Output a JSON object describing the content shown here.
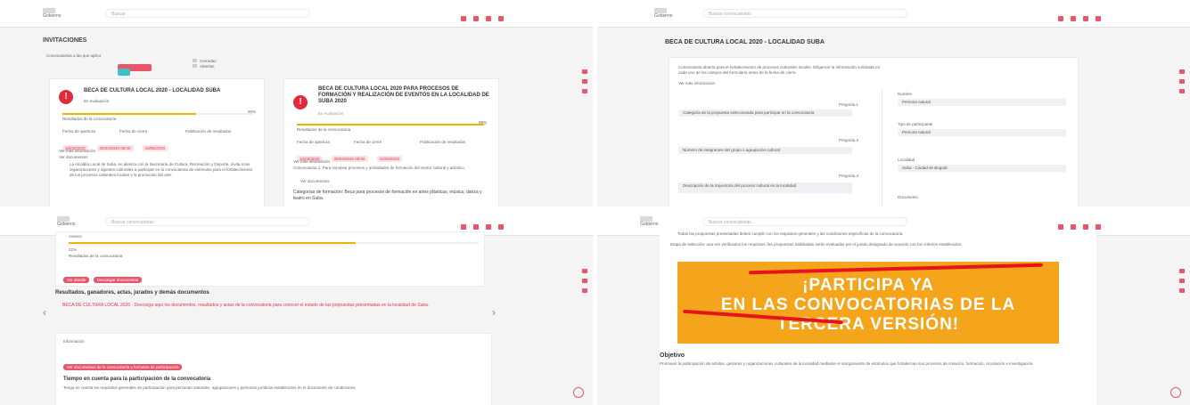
{
  "p1": {
    "brand": "Gobierno",
    "search_placeholder": "Buscar",
    "title": "INVITACIONES",
    "filter_label": "Convocatorias a las que aplico",
    "toggle_label": "Todas",
    "legend": [
      "Cerradas",
      "Abiertas"
    ],
    "card1": {
      "title": "BECA DE CULTURA LOCAL 2020 - LOCALIDAD SUBA",
      "status": "En evaluación",
      "progress_pct": 90,
      "progress_label": "90%",
      "progress_caption": "Resultados de la convocatoria",
      "dates_labels": [
        "Fecha de apertura",
        "Fecha de cierre",
        "Publicación de resultados"
      ],
      "dates": [
        "16/03/2020",
        "30/04/2020 08:00",
        "15/05/2020"
      ],
      "link1": "Ver más información",
      "link2": "Ver documentos",
      "body": "La Alcaldía Local de Suba, en alianza con la Secretaría de Cultura, Recreación y Deporte, invita a las organizaciones y agentes culturales a participar en la convocatoria de estímulos para el fortalecimiento de los procesos culturales locales y la promoción del arte."
    },
    "card2": {
      "title": "BECA DE CULTURA LOCAL 2020 PARA PROCESOS DE FORMACIÓN Y REALIZACIÓN DE EVENTOS EN LA LOCALIDAD DE SUBA 2020",
      "status": "En evaluación",
      "progress_pct": 98,
      "progress_label": "98%",
      "progress_caption": "Resultados de la convocatoria",
      "dates_labels": [
        "Fecha de apertura",
        "Fecha de cierre",
        "Publicación de resultados"
      ],
      "dates": [
        "16/03/2020",
        "30/04/2020 08:00",
        "15/05/2020"
      ],
      "link1": "Ver más información",
      "body": "Convocatoria 1. Para impulsar procesos y actividades de formación del sector cultural y artístico.",
      "link2": "Ver documentos",
      "body2": "Categorías de formación: Beca para procesos de formación en artes plásticas, música, danza y teatro en Suba."
    }
  },
  "p2": {
    "brand": "Gobierno",
    "search_placeholder": "Buscar convocatorias",
    "title": "BECA DE CULTURA LOCAL 2020 - LOCALIDAD SUBA",
    "intro": "Convocatoria abierta para el fortalecimiento de procesos culturales locales. Diligencie la información solicitada en cada uno de los campos del formulario antes de la fecha de cierre.",
    "intro_link": "Ver más información",
    "questions": [
      {
        "tag": "Pregunta 1",
        "text": "Categoría de la propuesta seleccionada para participar en la convocatoria"
      },
      {
        "tag": "Pregunta 2",
        "text": "Número de integrantes del grupo o agrupación cultural"
      },
      {
        "tag": "Pregunta 3",
        "text": "Descripción de la trayectoria del proceso cultural en la localidad"
      }
    ],
    "fields": [
      {
        "label": "Nombre",
        "value": "Persona natural"
      },
      {
        "label": "Tipo de participante",
        "value": "Persona natural"
      },
      {
        "label": "Localidad",
        "value": "Suba - Ciudad de Bogotá"
      },
      {
        "label": "Documento",
        "value": ""
      }
    ]
  },
  "p3": {
    "brand": "Gobierno",
    "search_placeholder": "Buscar convocatorias",
    "progress_label": "Avance",
    "progress_pct": 70,
    "small1": "22%",
    "small2": "Resultados de la convocatoria",
    "btn1": "Ver detalle",
    "btn2": "Descargar documentos",
    "section_title": "Resultados, ganadores, actas, jurados y demás documentos",
    "notice": "BECA DE CULTURA LOCAL 2020 - Descarga aquí los documentos, resultados y actas de la convocatoria para conocer el estado de las propuestas presentadas en la localidad de Suba.",
    "section2": "Información",
    "btn3": "Ver documentos de la convocatoria y formatos de participación",
    "subtitle": "Tiempo en cuenta para la participación de la convocatoria",
    "body": "Tenga en cuenta los requisitos generales de participación para personas naturales, agrupaciones y personas jurídicas establecidos en el documento de condiciones."
  },
  "p4": {
    "brand": "Gobierno",
    "search_placeholder": "Buscar convocatorias",
    "text1": "Todas las propuestas presentadas deben cumplir con los requisitos generales y las condiciones específicas de la convocatoria.",
    "text2": "Etapa de selección: una vez verificados los requisitos, las propuestas habilitadas serán evaluadas por el jurado designado de acuerdo con los criterios establecidos.",
    "banner_lines": [
      "¡PARTICIPA YA",
      "EN LAS CONVOCATORIAS DE LA",
      "TERCERA VERSIÓN!"
    ],
    "objective_title": "Objetivo",
    "objective_text": "Promover la participación de artistas, gestores y organizaciones culturales de la localidad mediante el otorgamiento de estímulos que fortalezcan sus procesos de creación, formación, circulación e investigación."
  }
}
